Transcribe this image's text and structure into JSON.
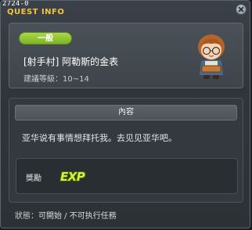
{
  "window": {
    "id_label": "2724-0",
    "title": "QUEST INFO"
  },
  "quest": {
    "category_badge": "一般",
    "name": "[射手村] 阿勒斯的金表",
    "level_range": "建議等級：10~14"
  },
  "content": {
    "header": "內容",
    "description": "亚华说有事情想拜托我。去见见亚华吧。"
  },
  "reward": {
    "label": "獎勵",
    "exp_text": "EXP"
  },
  "status": {
    "label": "狀態：",
    "state": "可開始 / 不可执行任務"
  },
  "colors": {
    "title": "#f2c63a",
    "badge_green": "#8cc430",
    "exp": "#d8f23b"
  }
}
